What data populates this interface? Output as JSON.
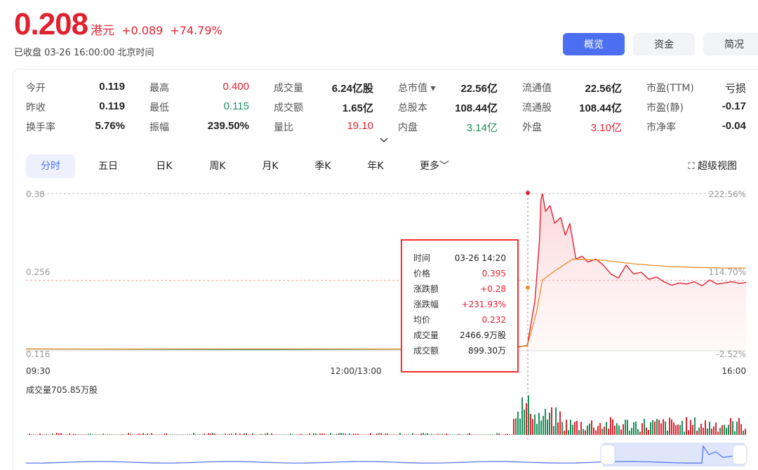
{
  "header": {
    "price": "0.208",
    "unit": "港元",
    "change": "+0.089",
    "change_pct": "+74.79%",
    "status": "已收盘 03-26 16:00:00 北京时间"
  },
  "top_tabs": [
    {
      "label": "概览",
      "active": true
    },
    {
      "label": "资金",
      "active": false
    },
    {
      "label": "简况",
      "active": false
    }
  ],
  "stats": {
    "row1": {
      "open_label": "今开",
      "open": "0.119",
      "high_label": "最高",
      "high": "0.400",
      "vol_label": "成交量",
      "vol": "6.24亿股",
      "mcap_label": "总市值 ▾",
      "mcap": "22.56亿",
      "float_cap_label": "流通值",
      "float_cap": "22.56亿",
      "pe_ttm_label": "市盈(TTM)",
      "pe_ttm": "亏损"
    },
    "row2": {
      "prev_label": "昨收",
      "prev": "0.119",
      "low_label": "最低",
      "low": "0.115",
      "amount_label": "成交额",
      "amount": "1.65亿",
      "shares_label": "总股本",
      "shares": "108.44亿",
      "float_shares_label": "流通股",
      "float_shares": "108.44亿",
      "pe_static_label": "市盈(静)",
      "pe_static": "-0.17"
    },
    "row3": {
      "turnover_label": "换手率",
      "turnover": "5.76%",
      "amp_label": "振幅",
      "amp": "239.50%",
      "vr_label": "量比",
      "vr": "19.10",
      "inner_label": "内盘",
      "inner": "3.14亿",
      "outer_label": "外盘",
      "outer": "3.10亿",
      "pb_label": "市净率",
      "pb": "-0.04"
    },
    "expand_icon": "chevron-down-icon"
  },
  "period_tabs": [
    "分时",
    "五日",
    "日K",
    "周K",
    "月K",
    "季K",
    "年K",
    "更多"
  ],
  "super_view": "超级视图",
  "chart_data": {
    "type": "line",
    "y_left_ticks": [
      "0.38",
      "0.256",
      "0.116"
    ],
    "y_right_ticks": [
      "222.56%",
      "114.70%",
      "-2.52%"
    ],
    "x_ticks": [
      "09:30",
      "12:00/13:00",
      "16:00"
    ],
    "ylim": [
      0.116,
      0.38
    ],
    "prev_close": 0.119,
    "price_series": [
      [
        0,
        0.119
      ],
      [
        150,
        0.118
      ],
      [
        300,
        0.119
      ],
      [
        320,
        0.12
      ],
      [
        330,
        0.125
      ],
      [
        335,
        0.2
      ],
      [
        338,
        0.3
      ],
      [
        339,
        0.37
      ],
      [
        340,
        0.38
      ],
      [
        342,
        0.35
      ],
      [
        345,
        0.36
      ],
      [
        348,
        0.33
      ],
      [
        352,
        0.34
      ],
      [
        355,
        0.31
      ],
      [
        358,
        0.33
      ],
      [
        362,
        0.27
      ],
      [
        366,
        0.275
      ],
      [
        370,
        0.265
      ],
      [
        375,
        0.27
      ],
      [
        380,
        0.26
      ],
      [
        385,
        0.245
      ],
      [
        390,
        0.238
      ],
      [
        395,
        0.26
      ],
      [
        400,
        0.245
      ],
      [
        405,
        0.248
      ],
      [
        410,
        0.236
      ],
      [
        415,
        0.24
      ],
      [
        420,
        0.232
      ],
      [
        425,
        0.226
      ],
      [
        430,
        0.23
      ],
      [
        435,
        0.228
      ],
      [
        440,
        0.232
      ],
      [
        445,
        0.225
      ],
      [
        450,
        0.235
      ],
      [
        455,
        0.228
      ],
      [
        460,
        0.23
      ],
      [
        465,
        0.232
      ],
      [
        470,
        0.229
      ],
      [
        474,
        0.231
      ]
    ],
    "avg_series": [
      [
        0,
        0.119
      ],
      [
        300,
        0.119
      ],
      [
        330,
        0.124
      ],
      [
        336,
        0.18
      ],
      [
        340,
        0.235
      ],
      [
        348,
        0.25
      ],
      [
        360,
        0.27
      ],
      [
        380,
        0.268
      ],
      [
        400,
        0.262
      ],
      [
        420,
        0.258
      ],
      [
        440,
        0.256
      ],
      [
        460,
        0.255
      ],
      [
        474,
        0.255
      ]
    ],
    "volume_label": "成交量705.85万股",
    "tooltip": {
      "time_label": "时间",
      "time": "03-26 14:20",
      "price_label": "价格",
      "price": "0.395",
      "chg_label": "涨跌额",
      "chg": "+0.28",
      "chg_pct_label": "涨跌幅",
      "chg_pct": "+231.93%",
      "avg_label": "均价",
      "avg": "0.232",
      "vol_label": "成交量",
      "vol": "2466.9万股",
      "amount_label": "成交额",
      "amount": "899.30万"
    }
  },
  "colors": {
    "up": "#e0212f",
    "down": "#1b8f5a",
    "avg_line": "#f08a24",
    "accent": "#4b6ff0",
    "navigator": "#4b6ff0"
  }
}
